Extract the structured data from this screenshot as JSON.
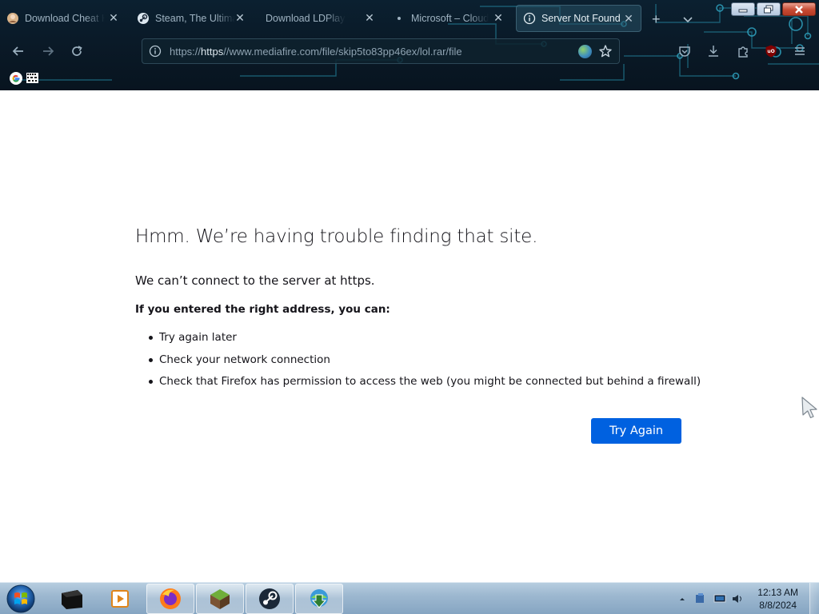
{
  "browser": {
    "tabs": [
      {
        "title": "Download Cheat H",
        "favicon": "cheat-site-icon",
        "active": false
      },
      {
        "title": "Steam, The Ultimat",
        "favicon": "steam-icon",
        "active": false
      },
      {
        "title": "Download LDPlayer - A",
        "favicon": "ldplayer-icon",
        "active": false
      },
      {
        "title": "Microsoft – Cloud",
        "favicon": "microsoft-dot-icon",
        "active": false
      },
      {
        "title": "Server Not Found",
        "favicon": "info-icon",
        "active": true
      }
    ],
    "url_scheme": "https://",
    "url_host": "https",
    "url_rest": "//www.mediafire.com/file/skip5to83pp46ex/lol.rar/file",
    "bookmarks": [
      {
        "name": "google-bookmark"
      },
      {
        "name": "offline-bookmark"
      }
    ]
  },
  "page": {
    "title": "Hmm. We’re having trouble finding that site.",
    "subtitle": "We can’t connect to the server at https.",
    "hint": "If you entered the right address, you can:",
    "suggestions": [
      "Try again later",
      "Check your network connection",
      "Check that Firefox has permission to access the web (you might be connected but behind a firewall)"
    ],
    "try_again_label": "Try Again"
  },
  "taskbar": {
    "clock_time": "12:13 AM",
    "clock_date": "8/8/2024",
    "pinned": [
      "app-black-box-icon",
      "media-player-icon",
      "firefox-icon",
      "minecraft-icon",
      "steam-icon",
      "download-manager-icon"
    ]
  },
  "colors": {
    "accent_blue": "#0061e0",
    "chrome_bg": "#0a1a28",
    "text_dark": "#15141a"
  }
}
